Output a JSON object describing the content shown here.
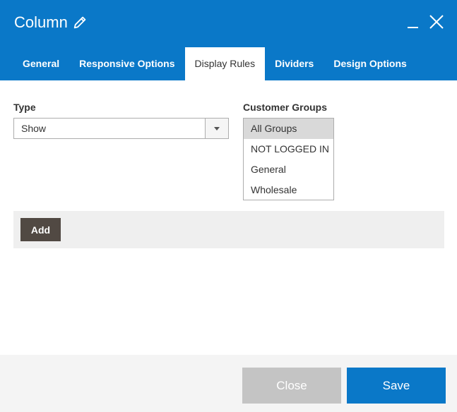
{
  "header": {
    "title": "Column",
    "edit_icon": "pencil-icon",
    "minimize_icon": "minimize-icon",
    "close_icon": "close-icon",
    "background": "#0a78c8"
  },
  "tabs": [
    {
      "label": "General",
      "active": false
    },
    {
      "label": "Responsive Options",
      "active": false
    },
    {
      "label": "Display Rules",
      "active": true
    },
    {
      "label": "Dividers",
      "active": false
    },
    {
      "label": "Design Options",
      "active": false
    }
  ],
  "form": {
    "type_label": "Type",
    "type_value": "Show",
    "groups_label": "Customer Groups",
    "groups": [
      {
        "label": "All Groups",
        "selected": true
      },
      {
        "label": "NOT LOGGED IN",
        "selected": false
      },
      {
        "label": "General",
        "selected": false
      },
      {
        "label": "Wholesale",
        "selected": false
      }
    ],
    "add_label": "Add"
  },
  "footer": {
    "close_label": "Close",
    "save_label": "Save"
  }
}
